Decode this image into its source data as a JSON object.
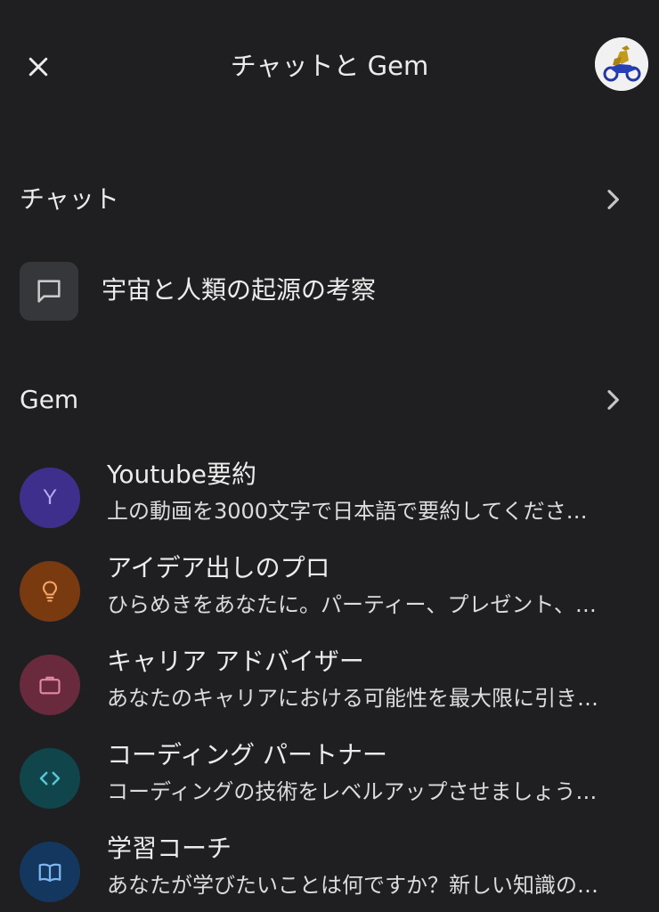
{
  "header": {
    "title": "チャットと Gem",
    "close_icon": "close-icon",
    "avatar": "user-avatar-motorcycle"
  },
  "chats_section": {
    "label": "チャット",
    "items": [
      {
        "title": "宇宙と人類の起源の考察",
        "icon": "chat-bubble-icon"
      }
    ]
  },
  "gems_section": {
    "label": "Gem",
    "items": [
      {
        "title": "Youtube要約",
        "description": "上の動画を3000文字で日本語で要約してくださ…",
        "badge": "Y",
        "icon": "letter-y",
        "color": "#3e2f8c",
        "fg": "#b7a9f5"
      },
      {
        "title": "アイデア出しのプロ",
        "description": "ひらめきをあなたに。パーティー、プレゼント、…",
        "icon": "lightbulb-icon",
        "color": "#7a3a10",
        "fg": "#f6a66a"
      },
      {
        "title": "キャリア アドバイザー",
        "description": "あなたのキャリアにおける可能性を最大限に引き…",
        "icon": "briefcase-icon",
        "color": "#6a2a3d",
        "fg": "#e38aa6"
      },
      {
        "title": "コーディング パートナー",
        "description": "コーディングの技術をレベルアップさせましょう…",
        "icon": "code-icon",
        "color": "#10454c",
        "fg": "#58c6d6"
      },
      {
        "title": "学習コーチ",
        "description": "あなたが学びたいことは何ですか？新しい知識の…",
        "icon": "open-book-icon",
        "color": "#13375e",
        "fg": "#7db6f0"
      }
    ]
  }
}
